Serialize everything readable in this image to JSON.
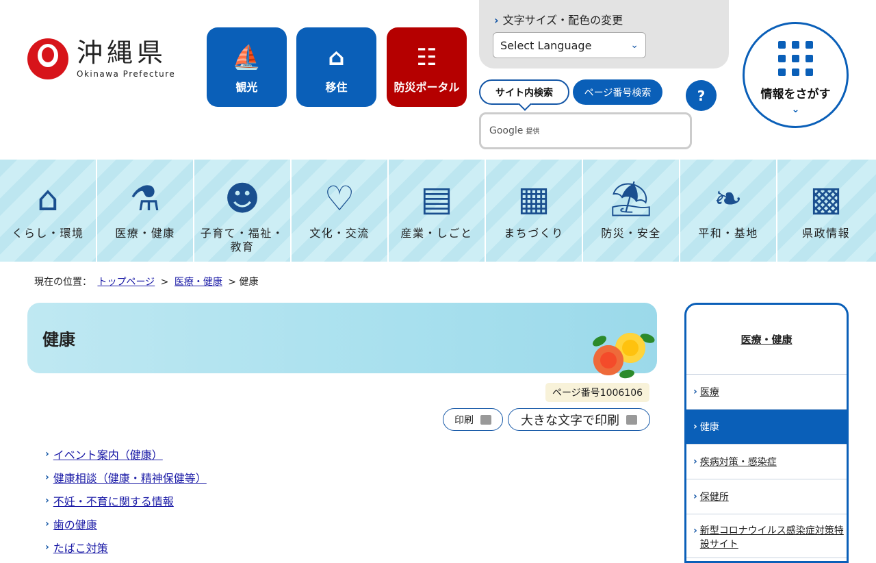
{
  "logo": {
    "jp": "沖縄県",
    "en": "Okinawa Prefecture"
  },
  "quick": [
    {
      "label": "観光",
      "icon": "tower-icon",
      "color": "#0a5fb8"
    },
    {
      "label": "移住",
      "icon": "house-icon",
      "color": "#0a5fb8"
    },
    {
      "label": "防災ポータル",
      "icon": "radio-icon",
      "color": "#b50000"
    }
  ],
  "settings": {
    "link": "文字サイズ・配色の変更",
    "language": "Select Language"
  },
  "search": {
    "tab_site": "サイト内検索",
    "tab_page": "ページ番号検索",
    "help": "?",
    "provider": "Google",
    "provider_note": "提供"
  },
  "find": {
    "label": "情報をさがす"
  },
  "categories": [
    {
      "label": "くらし・環境",
      "icon": "house-tree-icon"
    },
    {
      "label": "医療・健康",
      "icon": "syringe-icon"
    },
    {
      "label": "子育て・福祉・教育",
      "icon": "baby-icon"
    },
    {
      "label": "文化・交流",
      "icon": "heart-hands-icon"
    },
    {
      "label": "産業・しごと",
      "icon": "briefcase-icon"
    },
    {
      "label": "まちづくり",
      "icon": "buildings-icon"
    },
    {
      "label": "防災・安全",
      "icon": "helmet-bag-icon"
    },
    {
      "label": "平和・基地",
      "icon": "dove-icon"
    },
    {
      "label": "県政情報",
      "icon": "office-icon"
    }
  ],
  "breadcrumb": {
    "prefix": "現在の位置：",
    "home": "トップページ",
    "parent": "医療・健康",
    "sep": ">",
    "current": "健康"
  },
  "page": {
    "title": "健康",
    "page_number": "ページ番号1006106",
    "print": "印刷",
    "print_large": "大きな文字で印刷",
    "links": [
      "イベント案内（健康）",
      "健康相談（健康・精神保健等）",
      "不妊・不育に関する情報",
      "歯の健康",
      "たばこ対策"
    ]
  },
  "sidebar": {
    "heading": "医療・健康",
    "items": [
      "医療",
      "健康",
      "疾病対策・感染症",
      "保健所",
      "新型コロナウイルス感染症対策特設サイト"
    ]
  }
}
